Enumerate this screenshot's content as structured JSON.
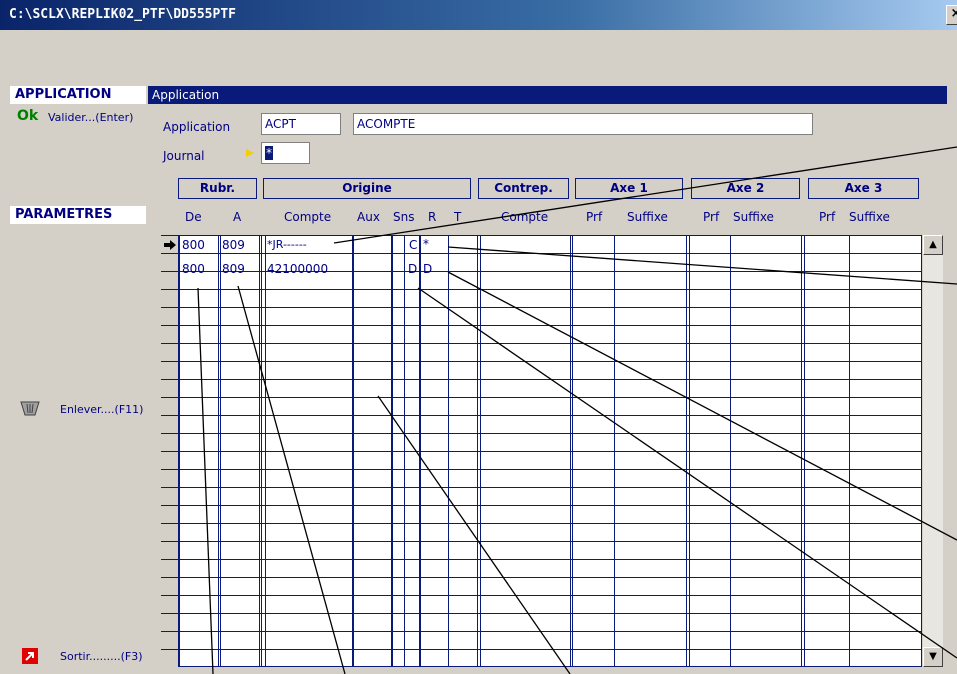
{
  "window": {
    "title": "C:\\SCLX\\REPLIK02_PTF\\DD555PTF",
    "close": "×"
  },
  "left": {
    "application_header": "APPLICATION",
    "parametres_header": "PARAMETRES",
    "ok_text": "Ok",
    "valider_label": "Valider...(Enter)",
    "enlever_label": "Enlever....(F11)",
    "sortir_label": "Sortir.........(F3)"
  },
  "section_bar": "Application",
  "form": {
    "application_label": "Application",
    "application_code": "ACPT",
    "application_desc": "ACOMPTE",
    "journal_label": "Journal",
    "journal_value": "*"
  },
  "group_headers": {
    "rubr": "Rubr.",
    "origine": "Origine",
    "contrep": "Contrep.",
    "axe1": "Axe 1",
    "axe2": "Axe 2",
    "axe3": "Axe 3"
  },
  "columns": {
    "de": "De",
    "a": "A",
    "compte": "Compte",
    "aux": "Aux",
    "sns": "Sns",
    "r": "R",
    "t": "T",
    "compte2": "Compte",
    "prf1": "Prf",
    "suffixe1": "Suffixe",
    "prf2": "Prf",
    "suffixe2": "Suffixe",
    "prf3": "Prf",
    "suffixe3": "Suffixe"
  },
  "rows": [
    {
      "de": "800",
      "a": "809",
      "compte": "*JR------",
      "sns": "C",
      "r": "*"
    },
    {
      "de": "800",
      "a": "809",
      "compte": "42100000",
      "sns": "D",
      "r": "D"
    }
  ],
  "icons": {
    "row_pointer": "arrow-right-icon",
    "delete": "trash-icon",
    "exit": "exit-icon",
    "scroll_up": "arrow-up-icon",
    "scroll_down": "arrow-down-icon"
  },
  "colors": {
    "title_bar": "#0a246a",
    "section_bar": "#0a1a7a",
    "ok_green": "#008000",
    "grid_lines": "#0a1a7a"
  }
}
